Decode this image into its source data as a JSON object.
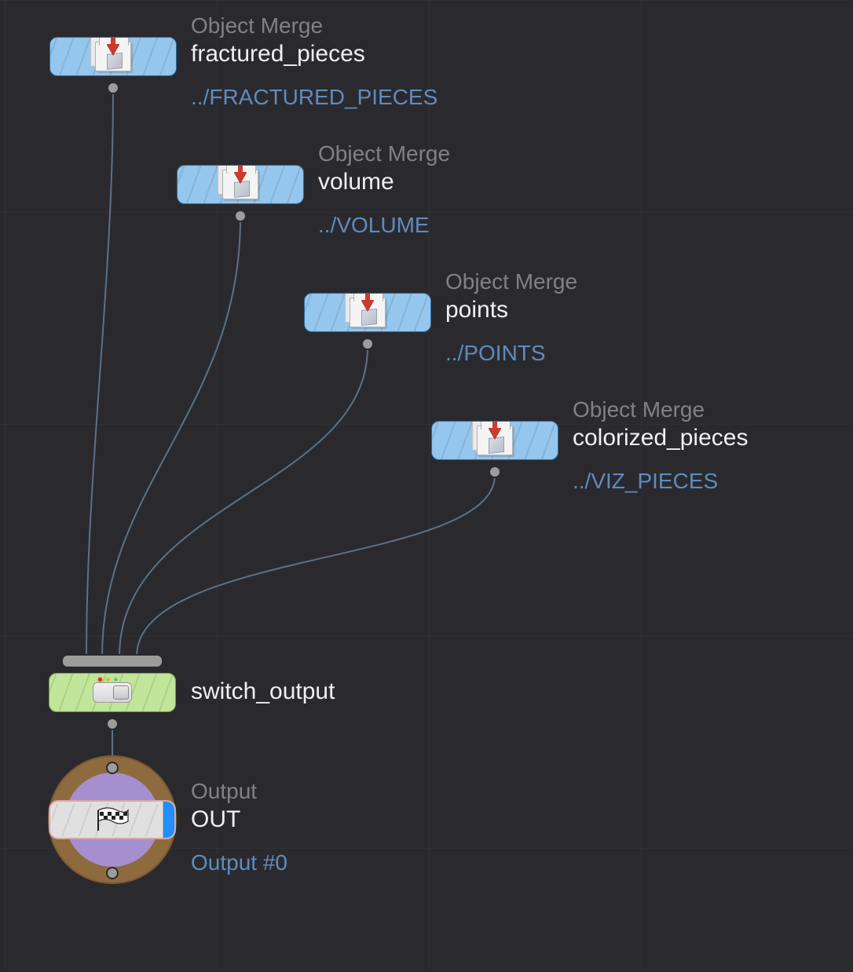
{
  "colors": {
    "node_blue": "#95c6ed",
    "node_green": "#c1e69a",
    "path_link": "#5f8bbd",
    "bg": "#2a2a2e"
  },
  "nodes": {
    "fractured": {
      "type_label": "Object Merge",
      "name": "fractured_pieces",
      "path": "../FRACTURED_PIECES",
      "icon": "object-merge-icon"
    },
    "volume": {
      "type_label": "Object Merge",
      "name": "volume",
      "path": "../VOLUME",
      "icon": "object-merge-icon"
    },
    "points": {
      "type_label": "Object Merge",
      "name": "points",
      "path": "../POINTS",
      "icon": "object-merge-icon"
    },
    "colorized": {
      "type_label": "Object Merge",
      "name": "colorized_pieces",
      "path": "../VIZ_PIECES",
      "icon": "object-merge-icon"
    },
    "switch": {
      "type_label": "",
      "name": "switch_output",
      "icon": "switch-icon"
    },
    "output": {
      "type_label": "Output",
      "name": "OUT",
      "path": "Output #0",
      "icon": "flag-icon",
      "display_flag": true
    }
  },
  "connections": [
    {
      "from": "fractured",
      "to": "switch",
      "to_input": 0
    },
    {
      "from": "volume",
      "to": "switch",
      "to_input": 1
    },
    {
      "from": "points",
      "to": "switch",
      "to_input": 2
    },
    {
      "from": "colorized",
      "to": "switch",
      "to_input": 3
    },
    {
      "from": "switch",
      "to": "output",
      "to_input": 0
    }
  ]
}
